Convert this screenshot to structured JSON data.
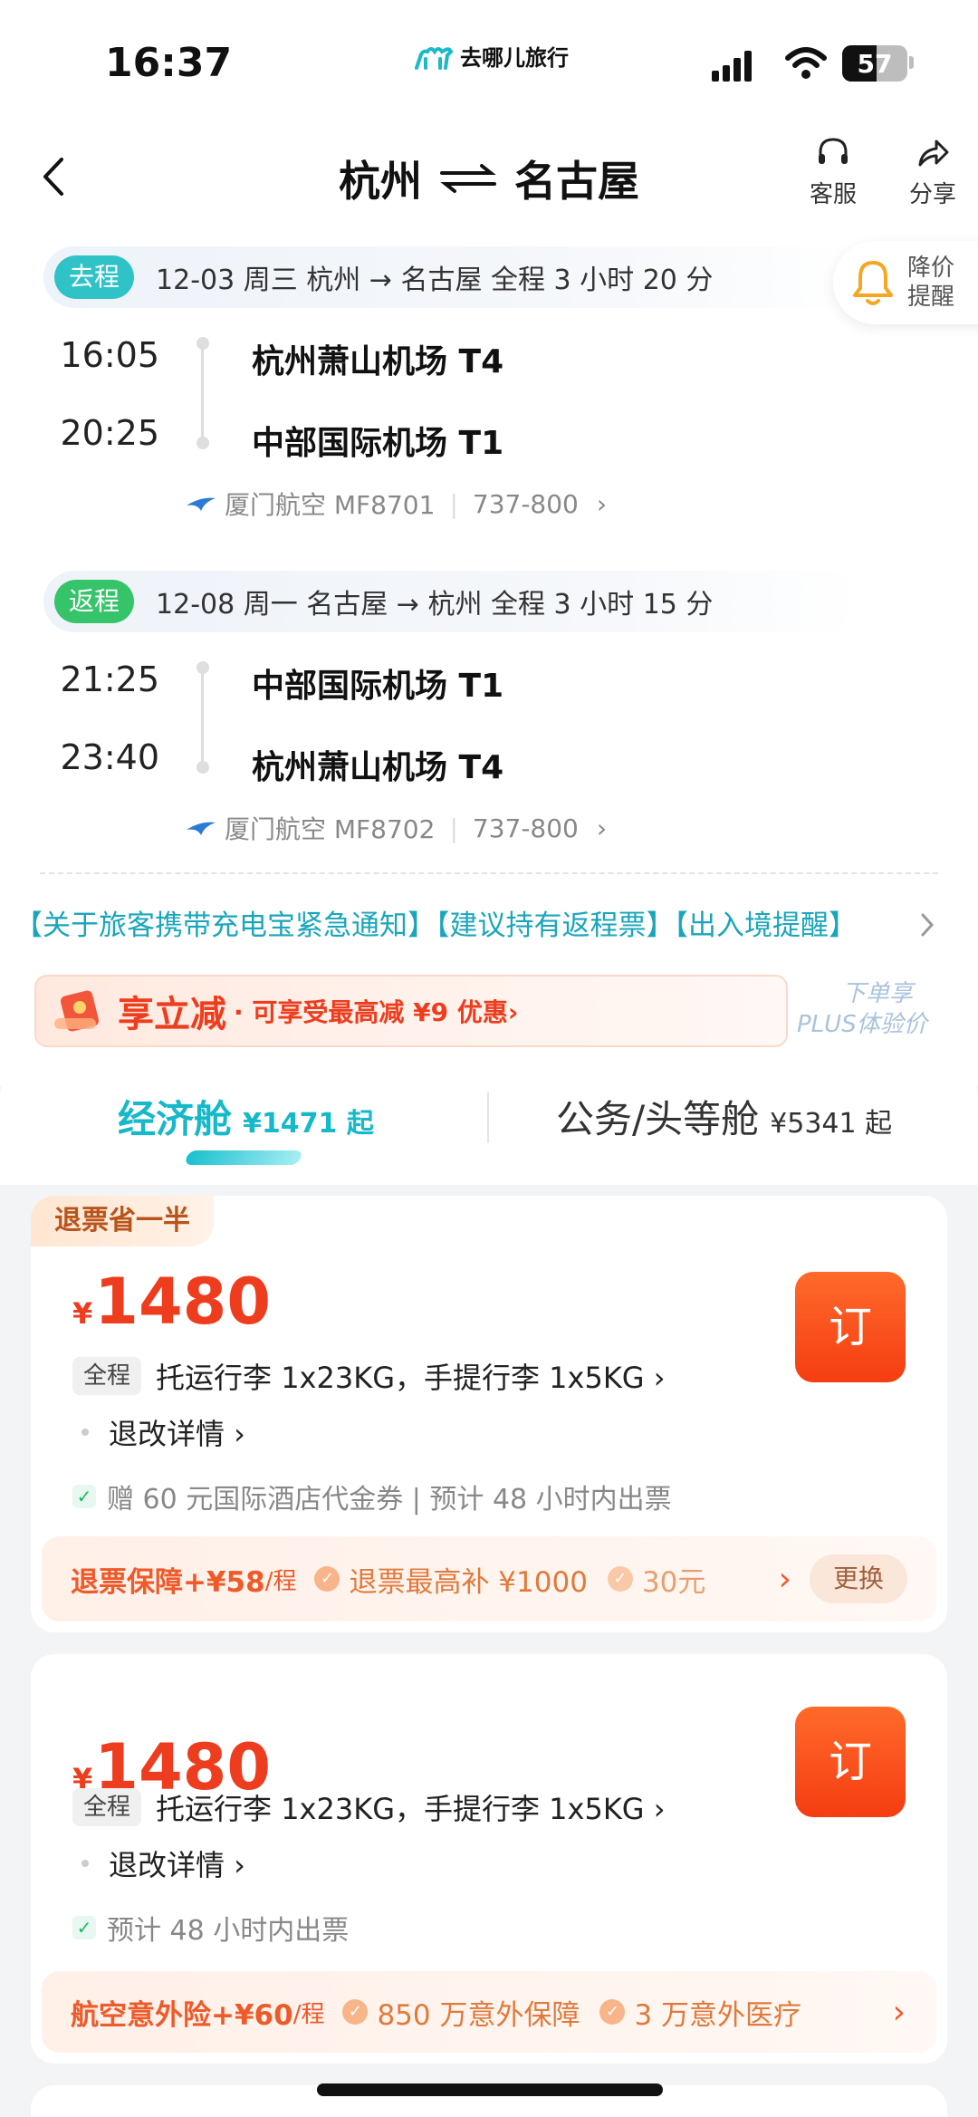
{
  "status": {
    "time": "16:37",
    "battery": "57",
    "brand": "去哪儿旅行"
  },
  "header": {
    "from": "杭州",
    "to": "名古屋",
    "service_label": "客服",
    "share_label": "分享"
  },
  "outbound": {
    "badge": "去程",
    "summary": "12-03 周三   杭州 → 名古屋   全程 3 小时 20 分",
    "dep_time": "16:05",
    "dep_airport": "杭州萧山机场 T4",
    "arr_time": "20:25",
    "arr_airport": "中部国际机场 T1",
    "airline": "厦门航空 MF8701",
    "aircraft": "737-800"
  },
  "inbound": {
    "badge": "返程",
    "summary": "12-08 周一   名古屋 → 杭州   全程 3 小时 15 分",
    "dep_time": "21:25",
    "dep_airport": "中部国际机场 T1",
    "arr_time": "23:40",
    "arr_airport": "杭州萧山机场 T4",
    "airline": "厦门航空 MF8702",
    "aircraft": "737-800"
  },
  "price_alert": {
    "line1": "降价",
    "line2": "提醒"
  },
  "notice": "【关于旅客携带充电宝紧急通知】【建议持有返程票】【出入境提醒】",
  "promo": {
    "title": "享立减",
    "sub": "· 可享受最高减 ¥9 优惠›",
    "plus_line1": "下单享",
    "plus_line2": "PLUS体验价"
  },
  "tabs": [
    {
      "label": "经济舱",
      "price": "¥1471 起"
    },
    {
      "label": "公务/头等舱",
      "price": "¥5341 起"
    }
  ],
  "fares": [
    {
      "tag": "退票省一半",
      "currency": "¥",
      "amount": "1480",
      "book": "订",
      "chip": "全程",
      "baggage": "托运行李 1x23KG，手提行李 1x5KG ›",
      "detail": "退改详情 ›",
      "note": "赠 60 元国际酒店代金券 | 预计 48 小时内出票",
      "ins_title": "退票保障+¥58",
      "ins_per": "/程",
      "ins_items": [
        "退票最高补 ¥1000",
        "30元"
      ],
      "ins_action": "更换"
    },
    {
      "currency": "¥",
      "amount": "1480",
      "book": "订",
      "chip": "全程",
      "baggage": "托运行李 1x23KG，手提行李 1x5KG ›",
      "detail": "退改详情 ›",
      "note": "预计 48 小时内出票",
      "ins_title": "航空意外险+¥60",
      "ins_per": "/程",
      "ins_items": [
        "850 万意外保障",
        "3 万意外医疗"
      ]
    }
  ],
  "colors": {
    "accent": "#16b9c9",
    "price": "#ee3d1e",
    "book": "#f53d12"
  }
}
